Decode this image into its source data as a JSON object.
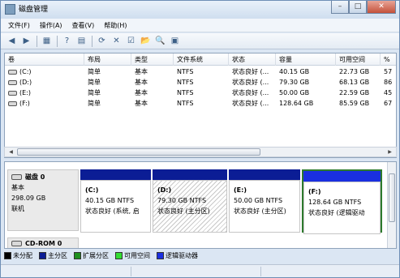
{
  "window": {
    "title": "磁盘管理",
    "min": "–",
    "max": "□",
    "close": "✕"
  },
  "menu": [
    "文件(F)",
    "操作(A)",
    "查看(V)",
    "帮助(H)"
  ],
  "toolbar": [
    "◀",
    "▶",
    "▦",
    "?",
    "▤",
    "⟳",
    "✕",
    "☑",
    "📂",
    "🔍",
    "▣"
  ],
  "columns": [
    "卷",
    "布局",
    "类型",
    "文件系统",
    "状态",
    "容量",
    "可用空间",
    "%"
  ],
  "volumes": [
    {
      "name": "(C:)",
      "layout": "简单",
      "type": "基本",
      "fs": "NTFS",
      "status": "状态良好 (...",
      "capacity": "40.15 GB",
      "free": "22.73 GB",
      "pct": "57"
    },
    {
      "name": "(D:)",
      "layout": "简单",
      "type": "基本",
      "fs": "NTFS",
      "status": "状态良好 (...",
      "capacity": "79.30 GB",
      "free": "68.13 GB",
      "pct": "86"
    },
    {
      "name": "(E:)",
      "layout": "简单",
      "type": "基本",
      "fs": "NTFS",
      "status": "状态良好 (...",
      "capacity": "50.00 GB",
      "free": "22.59 GB",
      "pct": "45"
    },
    {
      "name": "(F:)",
      "layout": "简单",
      "type": "基本",
      "fs": "NTFS",
      "status": "状态良好 (...",
      "capacity": "128.64 GB",
      "free": "85.59 GB",
      "pct": "67"
    }
  ],
  "disk0": {
    "name": "磁盘 0",
    "type": "基本",
    "size": "298.09 GB",
    "state": "联机"
  },
  "partitions": [
    {
      "vol": "(C:)",
      "size": "40.15 GB NTFS",
      "status": "状态良好 (系统, 启"
    },
    {
      "vol": "(D:)",
      "size": "79.30 GB NTFS",
      "status": "状态良好 (主分区)"
    },
    {
      "vol": "(E:)",
      "size": "50.00 GB NTFS",
      "status": "状态良好 (主分区)"
    },
    {
      "vol": "(F:)",
      "size": "128.64 GB NTFS",
      "status": "状态良好 (逻辑驱动"
    }
  ],
  "cdrom": {
    "name": "CD-ROM 0"
  },
  "legend": [
    {
      "label": "未分配",
      "color": "#000000"
    },
    {
      "label": "主分区",
      "color": "#0b1d95"
    },
    {
      "label": "扩展分区",
      "color": "#1e8f1e"
    },
    {
      "label": "可用空间",
      "color": "#33dd33"
    },
    {
      "label": "逻辑驱动器",
      "color": "#1a2fe0"
    }
  ]
}
